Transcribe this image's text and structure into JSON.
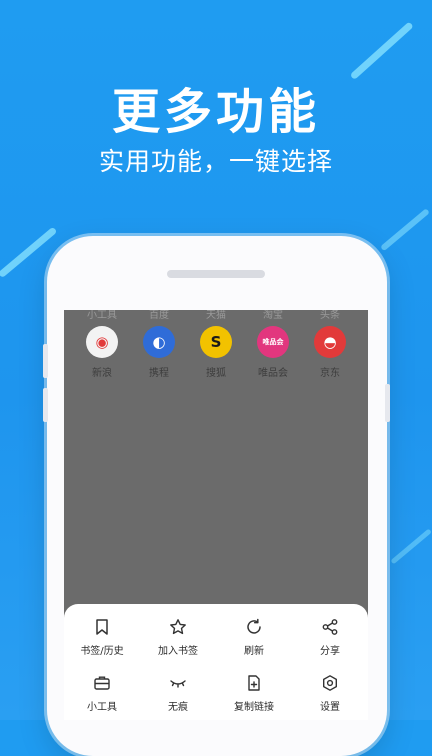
{
  "promo": {
    "headline": "更多功能",
    "subline": "实用功能，一键选择"
  },
  "background_top_labels": [
    "小工具",
    "百度",
    "天猫",
    "淘宝",
    "头条"
  ],
  "quick_sites": [
    {
      "label": "新浪",
      "icon": "weibo-icon",
      "color": "#ffffff",
      "glyph": "◉"
    },
    {
      "label": "携程",
      "icon": "ctrip-icon",
      "color": "#2f6cd8",
      "glyph": "◐"
    },
    {
      "label": "搜狐",
      "icon": "sohu-icon",
      "color": "#f2c200",
      "glyph": "S"
    },
    {
      "label": "唯品会",
      "icon": "vip-icon",
      "color": "#e2367e",
      "glyph": "唯品会"
    },
    {
      "label": "京东",
      "icon": "jd-icon",
      "color": "#e23a3a",
      "glyph": "◓"
    }
  ],
  "menu": {
    "items": [
      {
        "label": "书签/历史",
        "icon": "bookmark-icon"
      },
      {
        "label": "加入书签",
        "icon": "star-icon"
      },
      {
        "label": "刷新",
        "icon": "refresh-icon"
      },
      {
        "label": "分享",
        "icon": "share-icon"
      },
      {
        "label": "小工具",
        "icon": "toolbox-icon"
      },
      {
        "label": "无痕",
        "icon": "eye-closed-icon"
      },
      {
        "label": "复制链接",
        "icon": "copy-link-icon"
      },
      {
        "label": "设置",
        "icon": "settings-icon"
      }
    ]
  }
}
